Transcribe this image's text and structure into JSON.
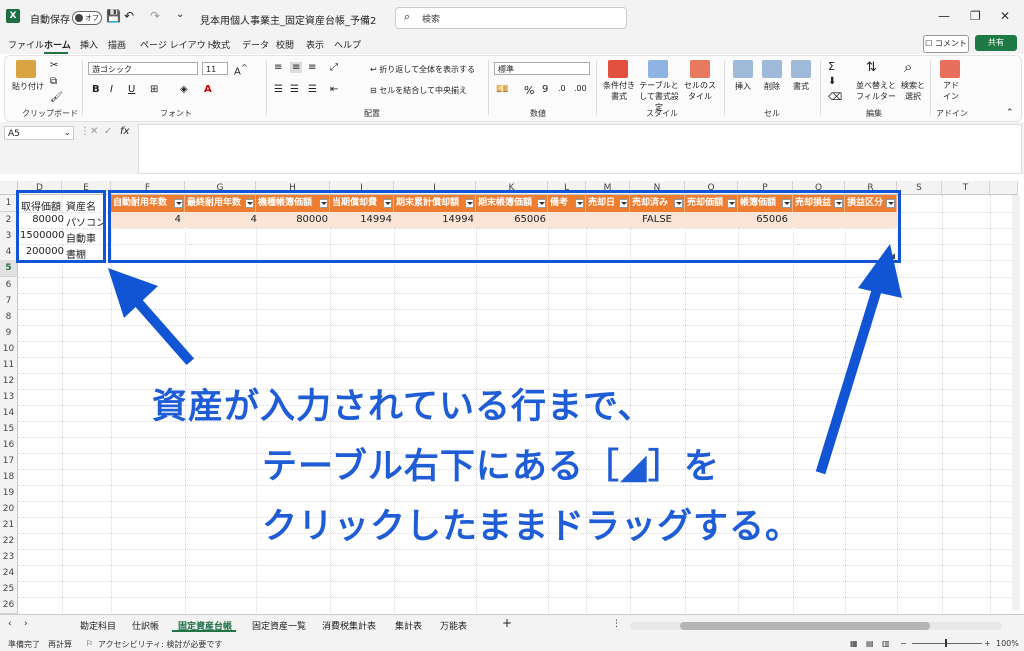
{
  "titlebar": {
    "app_icon": "X",
    "autosave_label": "自動保存",
    "autosave_state": "オフ",
    "filename": "見本用個人事業主_固定資産台帳_予備2",
    "search_placeholder": "検索"
  },
  "menu": [
    "ファイル",
    "ホーム",
    "挿入",
    "描画",
    "ページ レイアウト",
    "数式",
    "データ",
    "校閲",
    "表示",
    "ヘルプ"
  ],
  "menu_active": "ホーム",
  "header_buttons": {
    "comment": "コメント",
    "share": "共有"
  },
  "ribbon": {
    "groups": [
      "クリップボード",
      "フォント",
      "配置",
      "数値",
      "スタイル",
      "セル",
      "編集",
      "アドイン"
    ],
    "paste": "貼り付け",
    "font_name": "游ゴシック",
    "font_size": "11",
    "wrap_text": "折り返して全体を表示する",
    "merge_center": "セルを結合して中央揃え",
    "number_format": "標準",
    "cond_format": "条件付き書式",
    "format_table": "テーブルとして書式設定",
    "cell_styles": "セルのスタイル",
    "insert": "挿入",
    "delete": "削除",
    "format": "書式",
    "sort_filter": "並べ替えとフィルター",
    "find_select": "検索と選択",
    "addins": "アドイン"
  },
  "formula_bar": {
    "name_box": "A5",
    "fx": "fx"
  },
  "columns": [
    "D",
    "E",
    "F",
    "G",
    "H",
    "I",
    "J",
    "K",
    "L",
    "M",
    "N",
    "O",
    "P",
    "Q",
    "R",
    "S",
    "T"
  ],
  "rows": [
    "1",
    "2",
    "3",
    "4",
    "5",
    "6",
    "7",
    "8",
    "9",
    "10",
    "11",
    "12",
    "13",
    "14",
    "15",
    "16",
    "17",
    "18",
    "19",
    "20",
    "21",
    "22",
    "23",
    "24",
    "25",
    "26"
  ],
  "left_table": {
    "headers": [
      "取得価額",
      "資産名"
    ],
    "rows": [
      [
        "80000",
        "パソコン"
      ],
      [
        "1500000",
        "自動車"
      ],
      [
        "200000",
        "書棚"
      ]
    ]
  },
  "main_table": {
    "headers": [
      "自動耐用年数",
      "最終耐用年数",
      "機種帳簿価額",
      "当期償却費",
      "期末累計償却額",
      "期末帳簿価額",
      "備考",
      "売却日",
      "売却済み",
      "売却価額",
      "帳簿価額",
      "売却損益",
      "損益区分"
    ],
    "row1": [
      "4",
      "4",
      "80000",
      "14994",
      "14994",
      "65006",
      "",
      "",
      "FALSE",
      "",
      "65006",
      "",
      ""
    ]
  },
  "annotation": {
    "line1": "資産が入力されている行まで、",
    "line2": "テーブル右下にある［◢］を",
    "line3": "クリックしたままドラッグする。"
  },
  "sheet_tabs": [
    "勘定科目",
    "仕訳帳",
    "固定資産台帳",
    "固定資産一覧",
    "消費税集計表",
    "集計表",
    "万能表"
  ],
  "active_tab": "固定資産台帳",
  "status": {
    "ready": "準備完了",
    "recalc": "再計算",
    "accessibility": "アクセシビリティ: 検討が必要です",
    "zoom": "100%"
  },
  "colors": {
    "excel_green": "#217346",
    "table_header": "#ed7d31",
    "table_band": "#fbe5d6",
    "annotation_blue": "#1155d4"
  }
}
